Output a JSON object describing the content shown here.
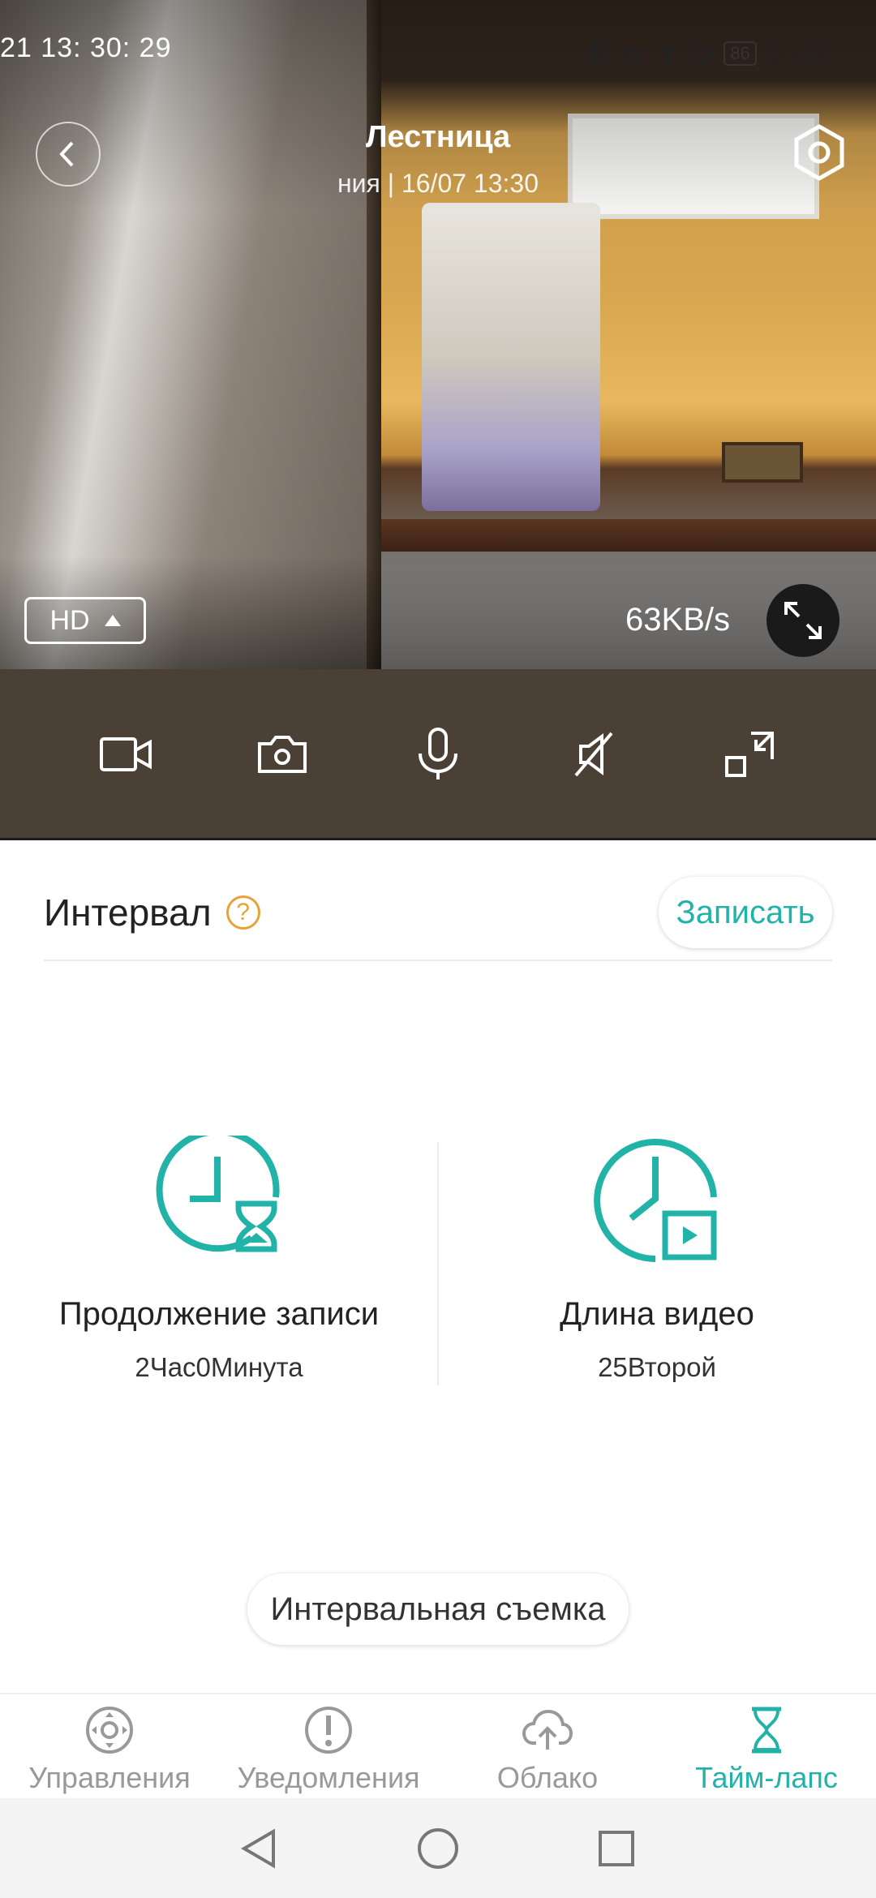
{
  "status_bar": {
    "left_text": "21  13: 30: 29",
    "battery": "86",
    "time": "13:30"
  },
  "camera": {
    "title": "Лестница",
    "subtitle": "ния | 16/07 13:30",
    "quality": "HD",
    "speed": "63KB/s",
    "icons": {
      "back": "chevron-left-icon",
      "settings": "camera-settings-icon",
      "fullscreen": "expand-icon"
    }
  },
  "controls": [
    {
      "name": "record-video-button",
      "icon": "video-camera-icon"
    },
    {
      "name": "snapshot-button",
      "icon": "camera-icon"
    },
    {
      "name": "microphone-button",
      "icon": "microphone-icon"
    },
    {
      "name": "mute-button",
      "icon": "speaker-muted-icon"
    },
    {
      "name": "collapse-button",
      "icon": "collapse-icon"
    }
  ],
  "interval": {
    "title": "Интервал",
    "help_symbol": "?",
    "record_label": "Записать"
  },
  "stats": {
    "duration_label": "Продолжение записи",
    "duration_value": "2Час0Минута",
    "video_length_label": "Длина видео",
    "video_length_value": "25Второй"
  },
  "timelapse_button": "Интервальная съемка",
  "tabs": [
    {
      "label": "Управления",
      "icon": "control-pad-icon",
      "active": false
    },
    {
      "label": "Уведомления",
      "icon": "alert-icon",
      "active": false
    },
    {
      "label": "Облако",
      "icon": "cloud-upload-icon",
      "active": false
    },
    {
      "label": "Тайм-лапс",
      "icon": "hourglass-icon",
      "active": true
    }
  ],
  "colors": {
    "accent": "#22b3a8",
    "help": "#e8a23a",
    "control_bar": "#4a4035"
  }
}
